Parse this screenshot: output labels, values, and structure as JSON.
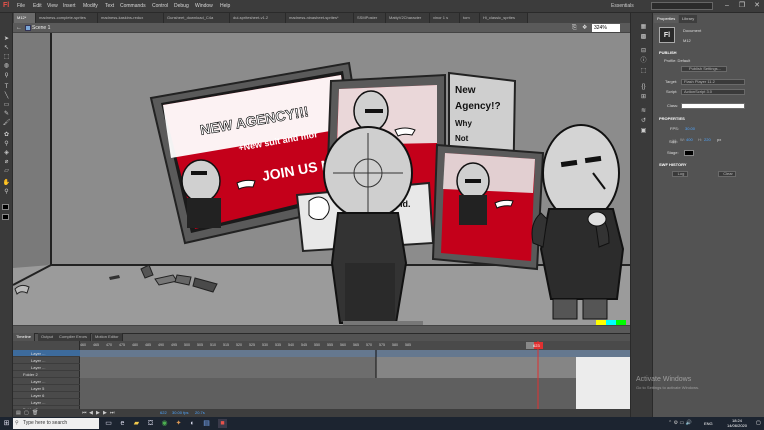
{
  "app": {
    "logo": "Fl"
  },
  "menu": [
    "File",
    "Edit",
    "View",
    "Insert",
    "Modify",
    "Text",
    "Commands",
    "Control",
    "Debug",
    "Window",
    "Help"
  ],
  "workspace": {
    "label": "Essentials",
    "search_placeholder": ""
  },
  "window_controls": {
    "minimize": "–",
    "restore": "❐",
    "close": "✕"
  },
  "doc_tabs": [
    "M12*",
    "madness-complete-sprites",
    "madness-kaskins-redux",
    "Gunsheet_download_C4a",
    "dui-spritesheet-v1.2",
    "madness-ninasheet-sprites*",
    "SSMPoster",
    "MattyV2Character",
    "xinor 1 s",
    "tom",
    "Hi_classic_sprites"
  ],
  "editbar": {
    "scene": "Scene 1",
    "zoom": "324%"
  },
  "stage_art": {
    "poster1_line1": "NEW AGENCY!!!",
    "poster1_line2": "+New suit and mor",
    "poster1_line3": "JOIN US NO",
    "poster2_line1": "New",
    "poster2_line2": "Agency!?",
    "poster2_line3": "Why",
    "poster2_line4": "Not",
    "poster3_text": "nd."
  },
  "timeline": {
    "tabs": [
      "Timeline",
      "Output",
      "Compiler Errors",
      "Motion Editor"
    ],
    "frame_numbers": [
      "460",
      "465",
      "470",
      "475",
      "480",
      "485",
      "490",
      "495",
      "500",
      "505",
      "510",
      "515",
      "520",
      "525",
      "530",
      "535",
      "540",
      "545",
      "550",
      "555",
      "560",
      "565",
      "570",
      "575",
      "580",
      "585",
      "590",
      "595",
      "600",
      "605",
      "610",
      "615",
      "620",
      "625",
      "630",
      "635",
      "640",
      "645",
      "650",
      "655"
    ],
    "current_frame_label": "623",
    "layers": [
      {
        "name": "Layer ...",
        "selected": true
      },
      {
        "name": "Layer ...",
        "selected": false
      },
      {
        "name": "Layer ...",
        "selected": false
      },
      {
        "name": "Folder 2",
        "selected": false
      },
      {
        "name": "Layer ...",
        "selected": false
      },
      {
        "name": "Layer 5",
        "selected": false
      },
      {
        "name": "Layer 6",
        "selected": false
      },
      {
        "name": "Layer ...",
        "selected": false
      },
      {
        "name": "Folder 2",
        "selected": false
      }
    ],
    "playbar": {
      "frame": "622",
      "fps": "30.00 fps",
      "time": "20.7s"
    }
  },
  "properties": {
    "tabs": [
      "Properties",
      "Library"
    ],
    "doc_type": "Document",
    "doc_name": "M12",
    "publish_header": "PUBLISH",
    "profile_label": "Profile: Default",
    "publish_settings_btn": "Publish Settings...",
    "target_label": "Target:",
    "target_value": "Flash Player 11.2",
    "script_label": "Script:",
    "script_value": "ActionScript 3.0",
    "class_label": "Class:",
    "properties_header": "PROPERTIES",
    "fps_label": "FPS:",
    "fps_value": "30.00",
    "size_label": "Size:",
    "width_value": "400",
    "height_value": "220",
    "unit": "px",
    "stage_label": "Stage:",
    "swf_header": "SWF HISTORY",
    "log_btn": "Log",
    "clear_btn": "Clear"
  },
  "watermark": {
    "line1": "Activate Windows",
    "line2": "Go to Settings to activate Windows."
  },
  "taskbar": {
    "search_placeholder": "Type here to search",
    "lang": "ENG",
    "time": "18:24",
    "date": "14/06/2020"
  },
  "colors": {
    "accent": "#3d6b9c",
    "playhead": "#e03030",
    "poster_red": "#c4001a"
  }
}
